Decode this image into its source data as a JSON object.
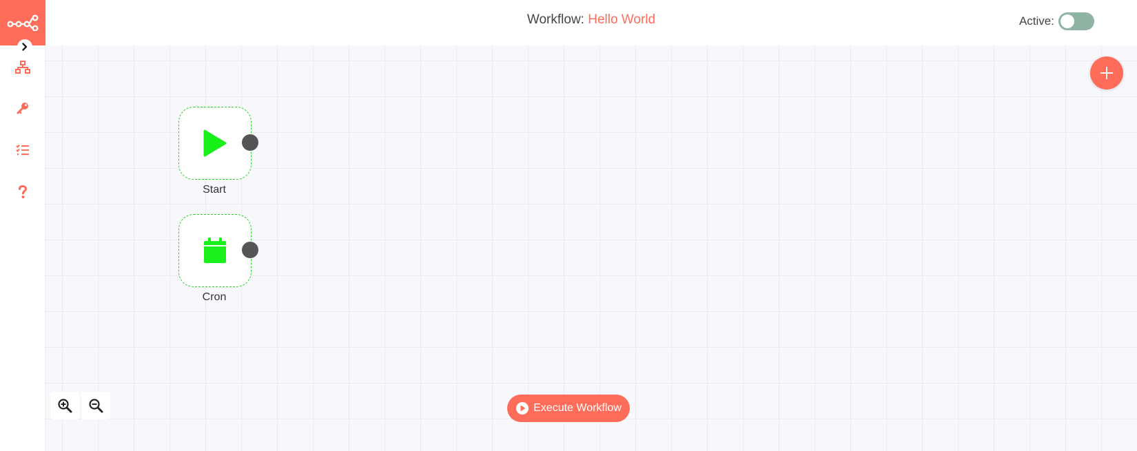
{
  "header": {
    "workflow_label": "Workflow:",
    "workflow_name": "Hello World",
    "active_label": "Active:",
    "active_state": false
  },
  "sidebar": {
    "logo_icon": "n8n-logo-icon",
    "expand_icon": "chevron-right-icon",
    "items": [
      {
        "icon": "workflow-network-icon"
      },
      {
        "icon": "key-icon"
      },
      {
        "icon": "tasks-list-icon"
      },
      {
        "icon": "question-icon"
      }
    ]
  },
  "canvas": {
    "nodes": [
      {
        "label": "Start",
        "icon": "play-icon"
      },
      {
        "label": "Cron",
        "icon": "calendar-icon"
      }
    ],
    "add_node_icon": "plus-icon",
    "zoom_in_icon": "zoom-in-icon",
    "zoom_out_icon": "zoom-out-icon"
  },
  "execute_button": {
    "label": "Execute Workflow",
    "icon": "play-circle-icon"
  },
  "colors": {
    "accent": "#ff6d5a",
    "node_icon": "#19ef19",
    "node_border": "#2bd12b",
    "endpoint": "#555555",
    "toggle_off": "#8fb3a2"
  }
}
